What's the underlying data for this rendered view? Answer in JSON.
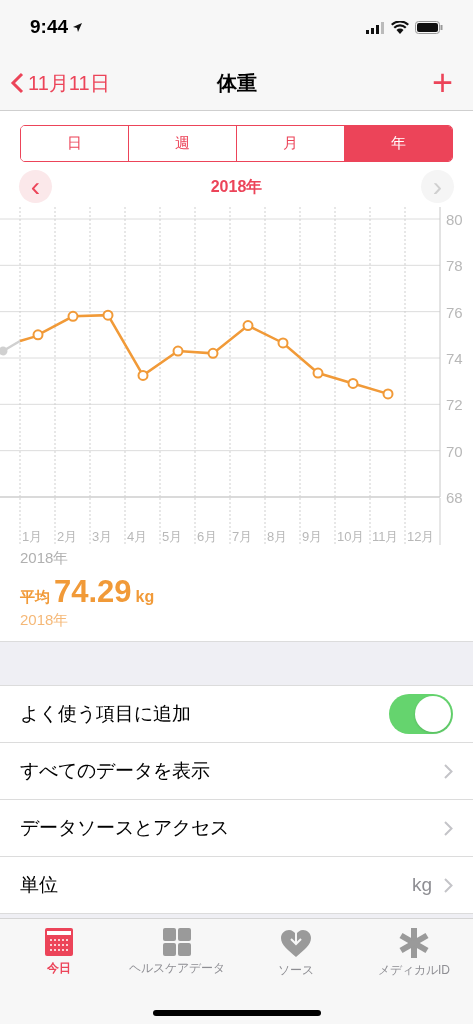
{
  "status_bar": {
    "time": "9:44"
  },
  "nav": {
    "back": "11月11日",
    "title": "体重",
    "add": "+"
  },
  "segments": [
    {
      "label": "日",
      "selected": false
    },
    {
      "label": "週",
      "selected": false
    },
    {
      "label": "月",
      "selected": false
    },
    {
      "label": "年",
      "selected": true
    }
  ],
  "period": {
    "prev": "‹",
    "label": "2018年",
    "next": "›",
    "next_disabled": true
  },
  "chart_data": {
    "type": "line",
    "categories": [
      "1月",
      "2月",
      "3月",
      "4月",
      "5月",
      "6月",
      "7月",
      "8月",
      "9月",
      "10月",
      "11月",
      "12月"
    ],
    "grid": true,
    "series": [
      {
        "color": "#f19a38",
        "marker": true,
        "values": [
          75.0,
          75.8,
          75.85,
          73.25,
          74.3,
          74.2,
          75.4,
          74.65,
          73.35,
          72.9,
          72.45,
          null
        ]
      }
    ],
    "ylim": [
      68,
      80
    ],
    "yticks": [
      68,
      70,
      72,
      74,
      76,
      78,
      80
    ]
  },
  "chart_caption": "2018年",
  "summary": {
    "label": "平均",
    "value": "74.29",
    "unit": "kg",
    "period": "2018年"
  },
  "settings": [
    {
      "kind": "toggle",
      "label": "よく使う項目に追加",
      "on": true
    },
    {
      "kind": "link",
      "label": "すべてのデータを表示"
    },
    {
      "kind": "link",
      "label": "データソースとアクセス"
    },
    {
      "kind": "value",
      "label": "単位",
      "value": "kg"
    }
  ],
  "tab_bar": [
    {
      "kind": "calendar",
      "label": "今日",
      "selected": true
    },
    {
      "kind": "grid",
      "label": "ヘルスケアデータ",
      "selected": false
    },
    {
      "kind": "heart",
      "label": "ソース",
      "selected": false
    },
    {
      "kind": "asterisk",
      "label": "メディカルID",
      "selected": false
    }
  ]
}
